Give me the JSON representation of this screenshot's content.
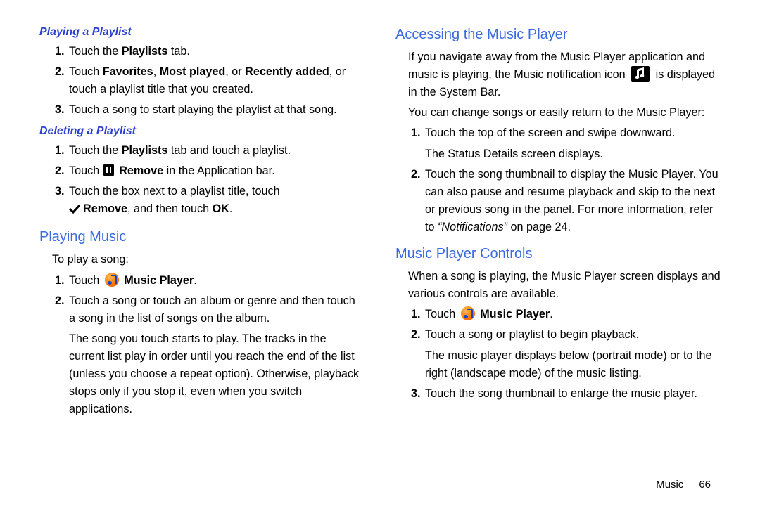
{
  "left": {
    "sub1": "Playing a Playlist",
    "pp_1a": "Touch the ",
    "pp_1b": "Playlists",
    "pp_1c": " tab.",
    "pp_2a": "Touch ",
    "pp_2_fav": "Favorites",
    "pp_2_c1": ", ",
    "pp_2_mp": "Most played",
    "pp_2_c2": ", or ",
    "pp_2_ra": "Recently added",
    "pp_2b": ", or touch a playlist title that you created.",
    "pp_3": "Touch a song to start playing the playlist at that song.",
    "sub2": "Deleting a Playlist",
    "dp_1a": "Touch the ",
    "dp_1b": "Playlists",
    "dp_1c": " tab and touch a playlist.",
    "dp_2a": "Touch ",
    "dp_2b": "Remove",
    "dp_2c": " in the Application bar.",
    "dp_3a": "Touch the box next to a playlist title, touch",
    "dp_3b": "Remove",
    "dp_3c": ", and then touch ",
    "dp_3d": "OK",
    "dp_3e": ".",
    "h1": "Playing Music",
    "pm_intro": "To play a song:",
    "pm_1a": "Touch ",
    "pm_1b": "Music Player",
    "pm_1c": ".",
    "pm_2": "Touch a song or touch an album or genre and then touch a song in the list of songs on the album.",
    "pm_2_cont": "The song you touch starts to play. The tracks in the current list play in order until you reach the end of the list (unless you choose a repeat option). Otherwise, playback stops only if you stop it, even when you switch applications."
  },
  "right": {
    "h1": "Accessing the Music Player",
    "amp_p1a": "If you navigate away from the Music Player application and music is playing, the Music notification icon ",
    "amp_p1b": " is displayed in the System Bar.",
    "amp_p2": "You can change songs or easily return to the Music Player:",
    "amp_1": "Touch the top of the screen and swipe downward.",
    "amp_1_cont": "The Status Details screen displays.",
    "amp_2a": "Touch the song thumbnail to display the Music Player. You can also pause and resume playback and skip to the next or previous song in the panel.  For more information, refer to ",
    "amp_2_ref": "“Notifications”",
    "amp_2b": " on page 24.",
    "h2": "Music Player Controls",
    "mpc_p1": "When a song is playing, the Music Player screen displays and various controls are available.",
    "mpc_1a": "Touch ",
    "mpc_1b": "Music Player",
    "mpc_1c": ".",
    "mpc_2": "Touch a song or playlist to begin playback.",
    "mpc_2_cont": "The music player displays below (portrait mode) or to the right (landscape mode) of the music listing.",
    "mpc_3": "Touch the song thumbnail to enlarge the music player."
  },
  "footer": {
    "section": "Music",
    "page": "66"
  }
}
